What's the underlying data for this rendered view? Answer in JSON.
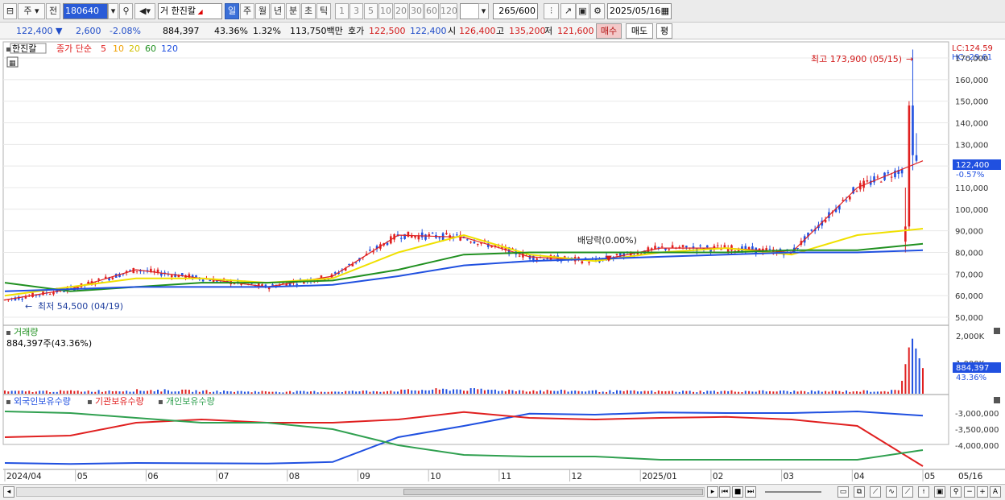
{
  "toolbar": {
    "period_select": "주",
    "prev_label": "전",
    "stock_code": "180640",
    "trade_label": "거",
    "stock_name": "한진칼",
    "periods": [
      "일",
      "주",
      "월",
      "년",
      "분",
      "초",
      "틱"
    ],
    "active_period": "일",
    "intervals": [
      "1",
      "3",
      "5",
      "10",
      "20",
      "30",
      "60",
      "120"
    ],
    "count": "265",
    "count_total": "/600",
    "date": "2025/05/16"
  },
  "quote": {
    "price": "122,400",
    "change": "2,600",
    "change_pct": "-2.08%",
    "volume": "884,397",
    "volume_ratio": "43.36%",
    "turnover": "1.32%",
    "amount": "113,750백만",
    "bid_label": "호가",
    "ask": "122,500",
    "bid": "122,400",
    "open_label": "시",
    "open": "126,400",
    "high_label": "고",
    "high": "135,200",
    "low_label": "저",
    "low": "121,600",
    "buy_button": "매수",
    "sell_button": "매도",
    "eval_button": "평"
  },
  "price_panel": {
    "stock_tag": "한진칼",
    "ma_title": "종가 단순",
    "ma_periods": [
      "5",
      "10",
      "20",
      "60",
      "120"
    ],
    "lc_label": "LC:124.59",
    "hc_label": "HC:-29.61",
    "high_note": "최고 173,900 (05/15)",
    "low_note": "최저 54,500 (04/19)",
    "dividend_note": "배당락(0.00%)",
    "last_price": "122,400",
    "last_pct": "-0.57%",
    "y_ticks": [
      "170,000",
      "160,000",
      "150,000",
      "140,000",
      "130,000",
      "120,000",
      "110,000",
      "100,000",
      "90,000",
      "80,000",
      "70,000",
      "60,000",
      "50,000"
    ]
  },
  "volume_panel": {
    "title": "거래량",
    "current": "884,397주(43.36%)",
    "y_top": "2,000K",
    "y_mid": "1,000K",
    "last_value": "884,397",
    "last_pct": "43.36%"
  },
  "holdings_panel": {
    "series": [
      "외국인보유수량",
      "기관보유수량",
      "개인보유수량"
    ],
    "y_ticks": [
      "-3,000,000",
      "-3,500,000",
      "-4,000,000"
    ]
  },
  "x_axis": [
    "2024/04",
    "05",
    "06",
    "07",
    "08",
    "09",
    "10",
    "11",
    "12",
    "2025/01",
    "02",
    "03",
    "04",
    "05",
    "05/16"
  ],
  "colors": {
    "ma5": "#e02020",
    "ma10": "#f0a000",
    "ma20": "#f0e000",
    "ma60": "#209020",
    "ma120": "#2050e0",
    "up": "#e02020",
    "down": "#2050e0",
    "foreign": "#2050e0",
    "institution": "#e02020",
    "individual": "#30a050"
  },
  "chart_data": [
    {
      "type": "line",
      "title": "한진칼",
      "x": [
        "2024/04",
        "05",
        "06",
        "07",
        "08",
        "09",
        "10",
        "11",
        "12",
        "2025/01",
        "02",
        "03",
        "04",
        "05",
        "05/16"
      ],
      "series": [
        {
          "name": "5",
          "values": [
            58000,
            63000,
            72000,
            68000,
            64000,
            69000,
            88000,
            87000,
            78000,
            76000,
            82000,
            82000,
            80000,
            110000,
            122400
          ]
        },
        {
          "name": "20",
          "values": [
            60000,
            64000,
            68000,
            68000,
            66000,
            68000,
            80000,
            88000,
            79000,
            76000,
            80000,
            82000,
            79000,
            88000,
            91000
          ]
        },
        {
          "name": "60",
          "values": [
            66000,
            62000,
            64000,
            66000,
            66000,
            67000,
            72000,
            79000,
            80000,
            80000,
            80000,
            80000,
            81000,
            81000,
            84000
          ]
        },
        {
          "name": "120",
          "values": [
            62000,
            63000,
            64000,
            64000,
            64000,
            65000,
            69000,
            74000,
            76000,
            77000,
            78000,
            79000,
            80000,
            80000,
            81000
          ]
        }
      ],
      "ylim": [
        50000,
        175000
      ],
      "annotations": [
        "최고 173,900 (05/15)",
        "최저 54,500 (04/19)",
        "배당락(0.00%)"
      ]
    },
    {
      "type": "bar",
      "title": "거래량",
      "ylabel": "",
      "ylim": [
        0,
        2000000
      ],
      "categories": [
        "2024/04",
        "05",
        "06",
        "07",
        "08",
        "09",
        "10",
        "11",
        "12",
        "2025/01",
        "02",
        "03",
        "04",
        "05",
        "05/16"
      ],
      "values": [
        80000,
        90000,
        120000,
        80000,
        70000,
        90000,
        150000,
        110000,
        90000,
        80000,
        90000,
        80000,
        100000,
        2000000,
        884397
      ]
    },
    {
      "type": "line",
      "x": [
        "2024/04",
        "05",
        "06",
        "07",
        "08",
        "09",
        "10",
        "11",
        "12",
        "2025/01",
        "02",
        "03",
        "04",
        "05",
        "05/16"
      ],
      "series": [
        {
          "name": "외국인보유수량",
          "values": [
            -4550000,
            -4580000,
            -4550000,
            -4560000,
            -4570000,
            -4520000,
            -3750000,
            -3400000,
            -3020000,
            -3050000,
            -2980000,
            -3000000,
            -3000000,
            -2950000,
            -3080000
          ]
        },
        {
          "name": "기관보유수량",
          "values": [
            -3750000,
            -3700000,
            -3300000,
            -3200000,
            -3300000,
            -3300000,
            -3200000,
            -2970000,
            -3150000,
            -3200000,
            -3150000,
            -3120000,
            -3200000,
            -3400000,
            -4650000
          ]
        },
        {
          "name": "개인보유수량",
          "values": [
            -2950000,
            -3000000,
            -3150000,
            -3300000,
            -3300000,
            -3500000,
            -4000000,
            -4300000,
            -4350000,
            -4350000,
            -4450000,
            -4450000,
            -4450000,
            -4450000,
            -4150000
          ]
        }
      ],
      "ylim": [
        -4700000,
        -2800000
      ]
    }
  ]
}
